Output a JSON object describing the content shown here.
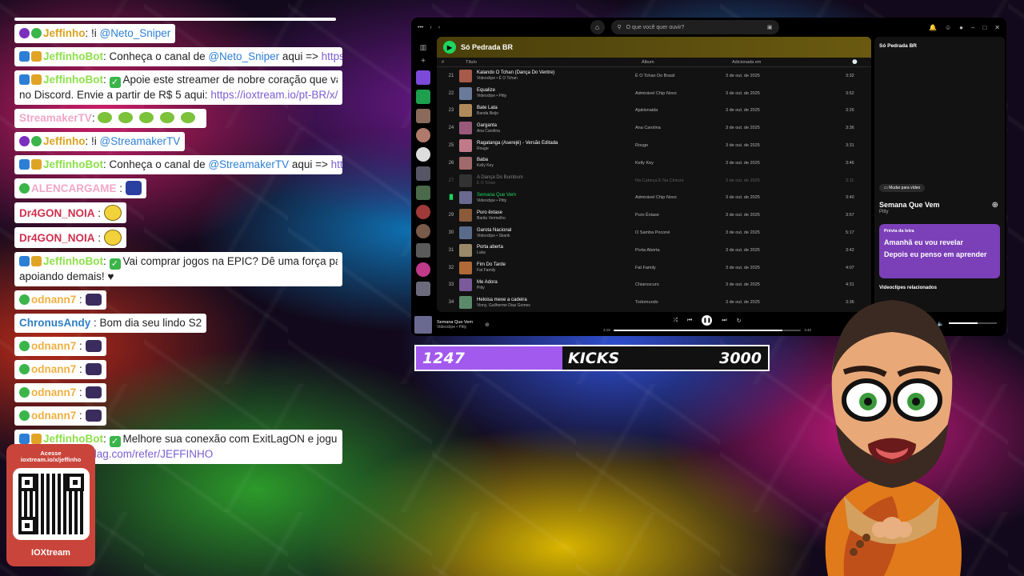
{
  "chat": {
    "messages": [
      {
        "user": "Jeffinho",
        "text": ": !i ",
        "mention": "@Neto_Sniper"
      },
      {
        "user": "JeffinhoBot",
        "text": ": Conheça o canal de ",
        "mention": "@Neto_Sniper",
        "after": " aqui => ",
        "link": "https://kic"
      },
      {
        "user": "JeffinhoBot",
        "text": "Apoie este streamer de nobre coração que vai to",
        "text2": "no Discord. Envie a partir de R$ 5 aqui: ",
        "link": "https://ioxtream.io/pt-BR/x/jeffi"
      },
      {
        "user": "StreamakerTV",
        "text": ":"
      },
      {
        "user": "Jeffinho",
        "text": ": !i ",
        "mention": "@StreamakerTV"
      },
      {
        "user": "JeffinhoBot",
        "text": ": Conheça o canal de ",
        "mention": "@StreamakerTV",
        "after": " aqui => ",
        "link": "https://"
      },
      {
        "user": "ALENCARGAME",
        "text": " : "
      },
      {
        "user": "Dr4GON_NOIA",
        "text": " : "
      },
      {
        "user": "Dr4GON_NOIA",
        "text": " : "
      },
      {
        "user": "JeffinhoBot",
        "text": "Vai comprar jogos na EPIC? Dê uma força para o J",
        "text2": "apoiando demais! ♥"
      },
      {
        "user": "odnann7",
        "text": " : "
      },
      {
        "user": "ChronusAndy",
        "text": " : Bom dia seu lindo S2"
      },
      {
        "user": "odnann7",
        "text": " : "
      },
      {
        "user": "odnann7",
        "text": " : "
      },
      {
        "user": "odnann7",
        "text": " : "
      },
      {
        "user": "odnann7",
        "text": " : "
      },
      {
        "user": "JeffinhoBot",
        "text": "Melhore sua conexão com ExitLagON e jogue sen",
        "link": "https://www.exitlag.com/refer/JEFFINHO"
      }
    ]
  },
  "qr": {
    "caption1": "Acesse",
    "caption2": "ioxtream.io/x/jeffinho",
    "brand": "IOXtream"
  },
  "spotify": {
    "search_placeholder": "O que você quer ouvir?",
    "playlist_title": "Só Pedrada BR",
    "col_num": "#",
    "col_title": "Título",
    "col_album": "Álbum",
    "col_added": "Adicionada em",
    "col_time": "🕒",
    "tracks": [
      {
        "n": "21",
        "title": "Kalando O Tchan (Dança Do Ventre)",
        "artist": "Videoclipe • É O Tchan",
        "album": "É O Tchan Do Brasil",
        "added": "3 de out. de 2025",
        "dur": "3:32"
      },
      {
        "n": "22",
        "title": "Equalize",
        "artist": "Videoclipe • Pitty",
        "album": "Admirável Chip Novo",
        "added": "3 de out. de 2025",
        "dur": "3:52"
      },
      {
        "n": "23",
        "title": "Bate Lata",
        "artist": "Banda Beijo",
        "album": "Ajakisnaida",
        "added": "3 de out. de 2025",
        "dur": "3:26"
      },
      {
        "n": "24",
        "title": "Garganta",
        "artist": "Ana Carolina",
        "album": "Ana Carolina",
        "added": "3 de out. de 2025",
        "dur": "3:36"
      },
      {
        "n": "25",
        "title": "Ragatanga (Aserejé) - Versão Editada",
        "artist": "Rouge",
        "album": "Rouge",
        "added": "3 de out. de 2025",
        "dur": "3:31"
      },
      {
        "n": "26",
        "title": "Baba",
        "artist": "Kelly Key",
        "album": "Kelly Key",
        "added": "3 de out. de 2025",
        "dur": "3:46"
      },
      {
        "n": "27",
        "title": "A Dança Do Bumbum",
        "artist": "É O Tchan",
        "album": "Na Cabeça E Na Cintura",
        "added": "3 de out. de 2025",
        "dur": "3:11"
      },
      {
        "n": "▐▌",
        "title": "Semana Que Vem",
        "artist": "Videoclipe • Pitty",
        "album": "Admirável Chip Novo",
        "added": "3 de out. de 2025",
        "dur": "3:40"
      },
      {
        "n": "29",
        "title": "Puro êxtase",
        "artist": "Barão Vermelho",
        "album": "Puro Êxtase",
        "added": "3 de out. de 2025",
        "dur": "3:57"
      },
      {
        "n": "30",
        "title": "Garota Nacional",
        "artist": "Videoclipe • Skank",
        "album": "O Samba Poconé",
        "added": "3 de out. de 2025",
        "dur": "5:17"
      },
      {
        "n": "31",
        "title": "Porta aberta",
        "artist": "Luka",
        "album": "Porta Aberta",
        "added": "3 de out. de 2025",
        "dur": "3:42"
      },
      {
        "n": "32",
        "title": "Fim Do Tarde",
        "artist": "Fat Family",
        "album": "Fat Family",
        "added": "3 de out. de 2025",
        "dur": "4:07"
      },
      {
        "n": "33",
        "title": "Me Adora",
        "artist": "Pitty",
        "album": "Chiaroscuro",
        "added": "3 de out. de 2025",
        "dur": "4:31"
      },
      {
        "n": "34",
        "title": "Heloisa mexe a cadeira",
        "artist": "Vinny, Guilherme Dias Gomes",
        "album": "Todomundo",
        "added": "3 de out. de 2025",
        "dur": "3:36"
      }
    ],
    "right_panel": {
      "playlist": "Só Pedrada BR",
      "switch_video": "Mudar para vídeo",
      "song": "Semana Que Vem",
      "artist": "Pitty",
      "lyrics_header": "Prévia da letra",
      "lyric1": "Amanhã eu vou revelar",
      "lyric2": "Depois eu penso em aprender",
      "related": "Videoclipes relacionados"
    },
    "player": {
      "title": "Semana Que Vem",
      "sub": "Videoclipe • Pitty",
      "elapsed": "3:19",
      "total": "3:40",
      "progress": 0.9,
      "volume": 0.6
    }
  },
  "goal": {
    "current": "1247",
    "label": "KICKS",
    "target": "3000",
    "fraction": 0.4157
  }
}
